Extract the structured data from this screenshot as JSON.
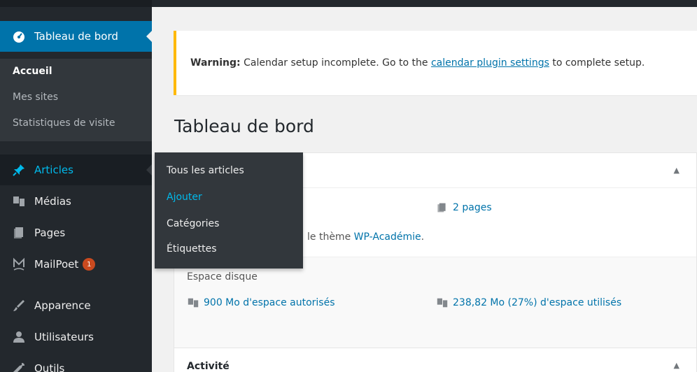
{
  "sidebar": {
    "dashboard": {
      "label": "Tableau de bord",
      "icon": "dashboard-icon"
    },
    "submenu": [
      "Accueil",
      "Mes sites",
      "Statistiques de visite"
    ],
    "items": [
      {
        "label": "Articles",
        "icon": "pin-icon"
      },
      {
        "label": "Médias",
        "icon": "media-icon"
      },
      {
        "label": "Pages",
        "icon": "pages-icon"
      },
      {
        "label": "MailPoet",
        "icon": "mailpoet-icon",
        "badge": "1"
      },
      {
        "label": "Apparence",
        "icon": "appearance-icon"
      },
      {
        "label": "Utilisateurs",
        "icon": "users-icon"
      },
      {
        "label": "Outils",
        "icon": "tools-icon"
      }
    ]
  },
  "flyout": {
    "items": [
      "Tous les articles",
      "Ajouter",
      "Catégories",
      "Étiquettes"
    ]
  },
  "notice": {
    "strong": "Warning:",
    "text_before": " Calendar setup incomplete. Go to the ",
    "link": "calendar plugin settings",
    "text_after": " to complete setup."
  },
  "page": {
    "title": "Tableau de bord"
  },
  "glance": {
    "pages": "2 pages",
    "theme_prefix": "le thème ",
    "theme_link": "WP-Académie",
    "theme_suffix": ".",
    "disk_label": "Espace disque",
    "disk_allowed": "900 Mo d'espace autorisés",
    "disk_used": "238,82 Mo (27%) d'espace utilisés"
  },
  "activity": {
    "title": "Activité"
  },
  "colors": {
    "sidebar": "#23282d",
    "accent": "#0073aa",
    "notice_border": "#ffb900",
    "badge": "#ca4a1f"
  }
}
